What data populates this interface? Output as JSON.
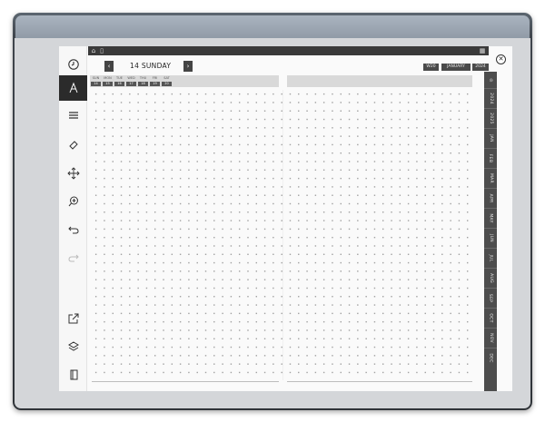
{
  "header": {
    "date_title": "14 SUNDAY",
    "prev_label": "‹",
    "next_label": "›",
    "week_label": "W20",
    "month_label": "JANUARY",
    "year_label": "2024"
  },
  "week": {
    "days": [
      "SUN",
      "MON",
      "TUE",
      "WED",
      "THU",
      "FRI",
      "SAT"
    ],
    "numbers": [
      "14",
      "15",
      "16",
      "17",
      "18",
      "19",
      "20"
    ]
  },
  "tabs": [
    "2024",
    "2025",
    "JAN",
    "FEB",
    "MAR",
    "APR",
    "MAY",
    "JUN",
    "JUL",
    "AUG",
    "SEP",
    "OCT",
    "NOV",
    "DEC"
  ],
  "toolbar": {
    "tools": [
      "timer-icon",
      "pen-icon",
      "lines-icon",
      "eraser-icon",
      "move-icon",
      "zoom-icon",
      "undo-icon",
      "redo-icon",
      "share-icon",
      "layers-icon",
      "page-icon"
    ]
  },
  "close_label": "✕"
}
